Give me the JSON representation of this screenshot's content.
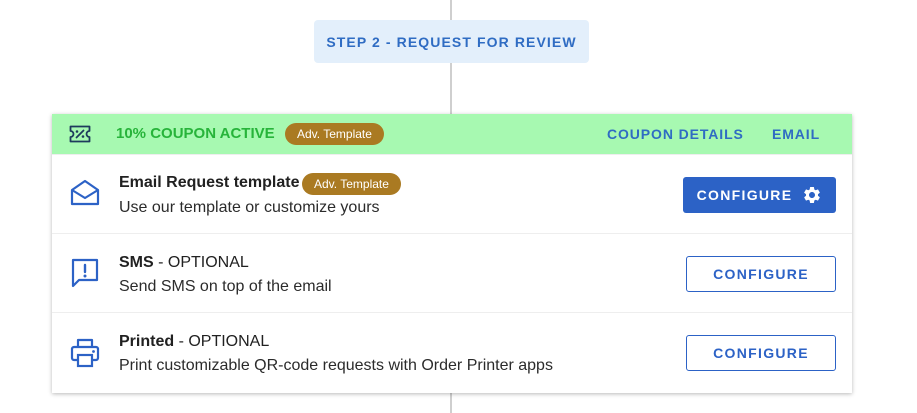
{
  "step": {
    "label": "STEP 2 - REQUEST FOR REVIEW"
  },
  "coupon": {
    "icon": "ticket-percent-icon",
    "text": "10% COUPON ACTIVE",
    "badge": "Adv. Template",
    "details_link": "COUPON DETAILS",
    "email_link": "EMAIL"
  },
  "rows": [
    {
      "icon": "envelope-open-icon",
      "title": "Email Request template",
      "badge": "Adv. Template",
      "description": "Use our template or customize yours",
      "button": "CONFIGURE",
      "button_icon": "gear-icon"
    },
    {
      "icon": "message-alert-icon",
      "title": "SMS",
      "title_suffix": " - OPTIONAL",
      "description": "Send SMS on top of the email",
      "button": "CONFIGURE"
    },
    {
      "icon": "printer-icon",
      "title": "Printed",
      "title_suffix": " - OPTIONAL",
      "description": "Print customizable QR-code requests with Order Printer apps",
      "button": "CONFIGURE"
    }
  ],
  "colors": {
    "accent": "#2c62c6",
    "coupon_bg": "#a7f9b1",
    "coupon_text": "#27b43a",
    "badge_bg": "#aa7a22",
    "step_bg": "#e3effb"
  }
}
